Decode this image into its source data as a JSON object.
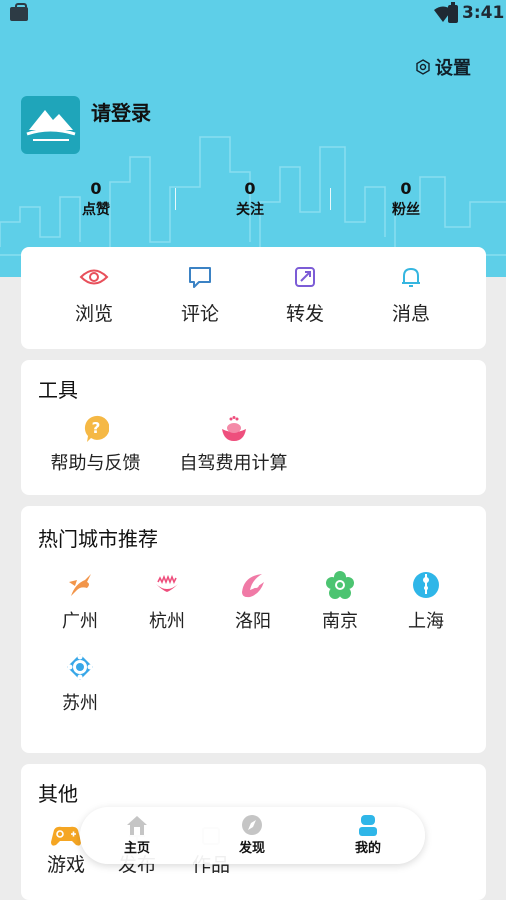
{
  "status_bar": {
    "time": "3:41"
  },
  "header": {
    "settings_label": "设置",
    "login_text": "请登录",
    "stats": [
      {
        "value": "0",
        "label": "点赞"
      },
      {
        "value": "0",
        "label": "关注"
      },
      {
        "value": "0",
        "label": "粉丝"
      }
    ]
  },
  "quick_actions": [
    {
      "label": "浏览",
      "icon": "eye-icon",
      "color": "#e8505b"
    },
    {
      "label": "评论",
      "icon": "comment-icon",
      "color": "#3b82c4"
    },
    {
      "label": "转发",
      "icon": "share-icon",
      "color": "#7c5cd6"
    },
    {
      "label": "消息",
      "icon": "bell-icon",
      "color": "#35b6e0"
    }
  ],
  "tools": {
    "title": "工具",
    "items": [
      {
        "label": "帮助与反馈",
        "icon": "help-icon",
        "color": "#f5b845"
      },
      {
        "label": "自驾费用计算",
        "icon": "ingot-icon",
        "color": "#ee4f7d"
      }
    ]
  },
  "cities": {
    "title": "热门城市推荐",
    "items": [
      {
        "label": "广州",
        "icon": "guangzhou-icon",
        "color": "#f2954a"
      },
      {
        "label": "杭州",
        "icon": "hangzhou-icon",
        "color": "#ee4f7d"
      },
      {
        "label": "洛阳",
        "icon": "luoyang-icon",
        "color": "#f07aa6"
      },
      {
        "label": "南京",
        "icon": "nanjing-icon",
        "color": "#4cc471"
      },
      {
        "label": "上海",
        "icon": "shanghai-icon",
        "color": "#2fb6e8"
      },
      {
        "label": "苏州",
        "icon": "suzhou-icon",
        "color": "#38a7e8"
      }
    ]
  },
  "other": {
    "title": "其他",
    "items": [
      {
        "label": "游戏",
        "icon": "gamepad-icon",
        "color": "#f5a623"
      },
      {
        "label": "发布",
        "icon": "publish-icon"
      },
      {
        "label": "作品",
        "icon": "works-icon"
      }
    ]
  },
  "bottom_nav": [
    {
      "label": "主页",
      "icon": "home-icon"
    },
    {
      "label": "发现",
      "icon": "discover-icon"
    },
    {
      "label": "我的",
      "icon": "profile-icon",
      "color": "#2fb6e8"
    }
  ]
}
